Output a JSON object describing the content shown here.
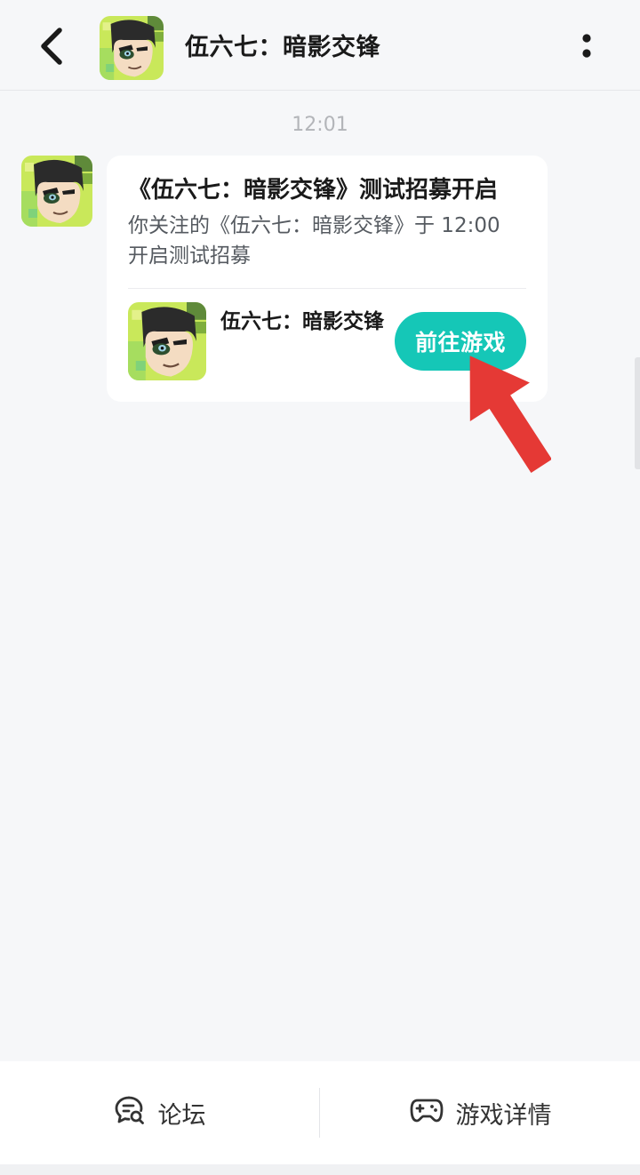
{
  "header": {
    "title": "伍六七：暗影交锋",
    "back_icon": "chevron-left-icon",
    "more_icon": "more-vertical-icon"
  },
  "message": {
    "time": "12:01",
    "title": "《伍六七：暗影交锋》测试招募开启",
    "body": "你关注的《伍六七：暗影交锋》于 12:00 开启测试招募",
    "game_name": "伍六七：暗影交锋",
    "button_label": "前往游戏"
  },
  "bottom_bar": {
    "forum_label": "论坛",
    "forum_icon": "forum-chat-icon",
    "detail_label": "游戏详情",
    "detail_icon": "gamepad-icon"
  },
  "colors": {
    "accent": "#15c7b7",
    "annotation_arrow": "#e53935",
    "background": "#f6f7f9"
  }
}
